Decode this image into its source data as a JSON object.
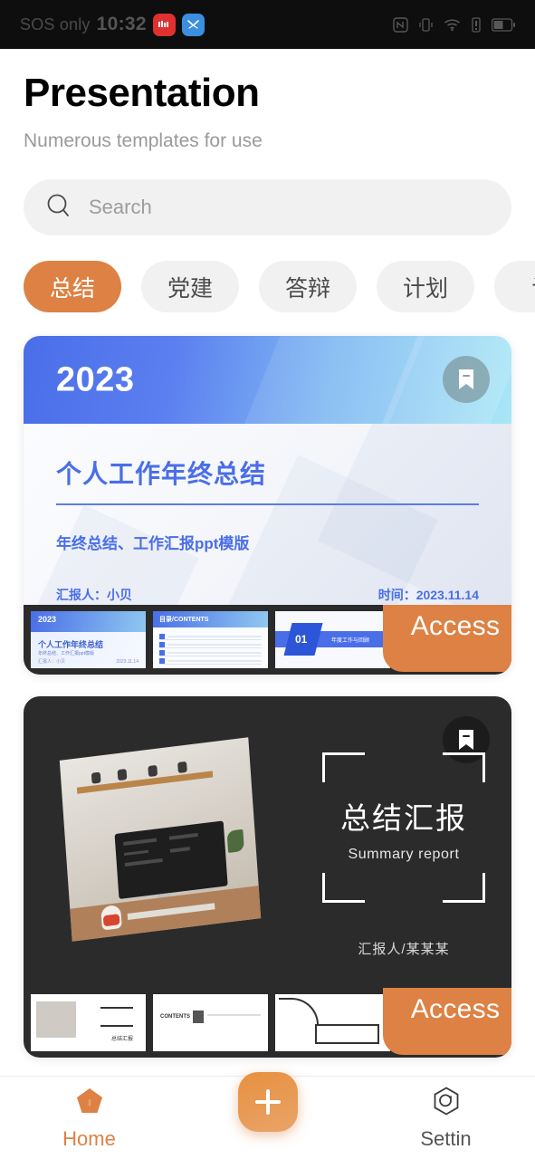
{
  "statusbar": {
    "carrier": "SOS only",
    "time": "10:32",
    "notif_icons": [
      "app-badge-red",
      "app-badge-blue"
    ],
    "right_icons": [
      "nfc-icon",
      "vibrate-icon",
      "wifi-icon",
      "signal-icon",
      "battery-icon"
    ]
  },
  "header": {
    "title": "Presentation",
    "subtitle": "Numerous templates for use"
  },
  "search": {
    "placeholder": "Search",
    "value": "",
    "icon": "search-icon"
  },
  "categories": [
    {
      "label": "总结",
      "active": true
    },
    {
      "label": "党建",
      "active": false
    },
    {
      "label": "答辩",
      "active": false
    },
    {
      "label": "计划",
      "active": false
    },
    {
      "label": "论",
      "active": false
    }
  ],
  "cards": [
    {
      "theme": "blue",
      "year": "2023",
      "title": "个人工作年终总结",
      "subtitle": "年终总结、工作汇报ppt模版",
      "presenter": "汇报人：小贝",
      "date": "时间：2023.11.14",
      "bookmark_icon": "bookmark-icon",
      "access_label": "Access",
      "thumbnails": [
        {
          "kind": "cover",
          "year": "2023",
          "title": "个人工作年终总结",
          "sub": "年终总结、工作汇报ppt模版",
          "f1": "汇报人：小贝",
          "f2": "2023.11.14"
        },
        {
          "kind": "contents",
          "header": "目录/CONTENTS"
        },
        {
          "kind": "section",
          "number": "01",
          "label": "年度工作与回顾"
        },
        {
          "kind": "text"
        }
      ]
    },
    {
      "theme": "dark",
      "title": "总结汇报",
      "subtitle": "Summary report",
      "author": "汇报人/某某某",
      "bookmark_icon": "bookmark-icon",
      "access_label": "Access",
      "thumbnails": [
        {
          "kind": "photo-cover",
          "caption": "总结汇报"
        },
        {
          "kind": "contents-dark",
          "header": "CONTENTS"
        },
        {
          "kind": "arc"
        },
        {
          "kind": "text"
        }
      ]
    }
  ],
  "bottomnav": {
    "items": [
      {
        "label": "Home",
        "icon": "home-pentagon-icon",
        "active": true
      },
      {
        "label": "Settin",
        "icon": "settings-hexagon-icon",
        "active": false
      }
    ],
    "fab": {
      "icon": "plus-icon",
      "label": "+"
    }
  },
  "colors": {
    "accent": "#dd8244",
    "card_blue": "#4a6ee8",
    "card_dark": "#2b2b2b",
    "chip_bg": "#f1f1f1"
  }
}
